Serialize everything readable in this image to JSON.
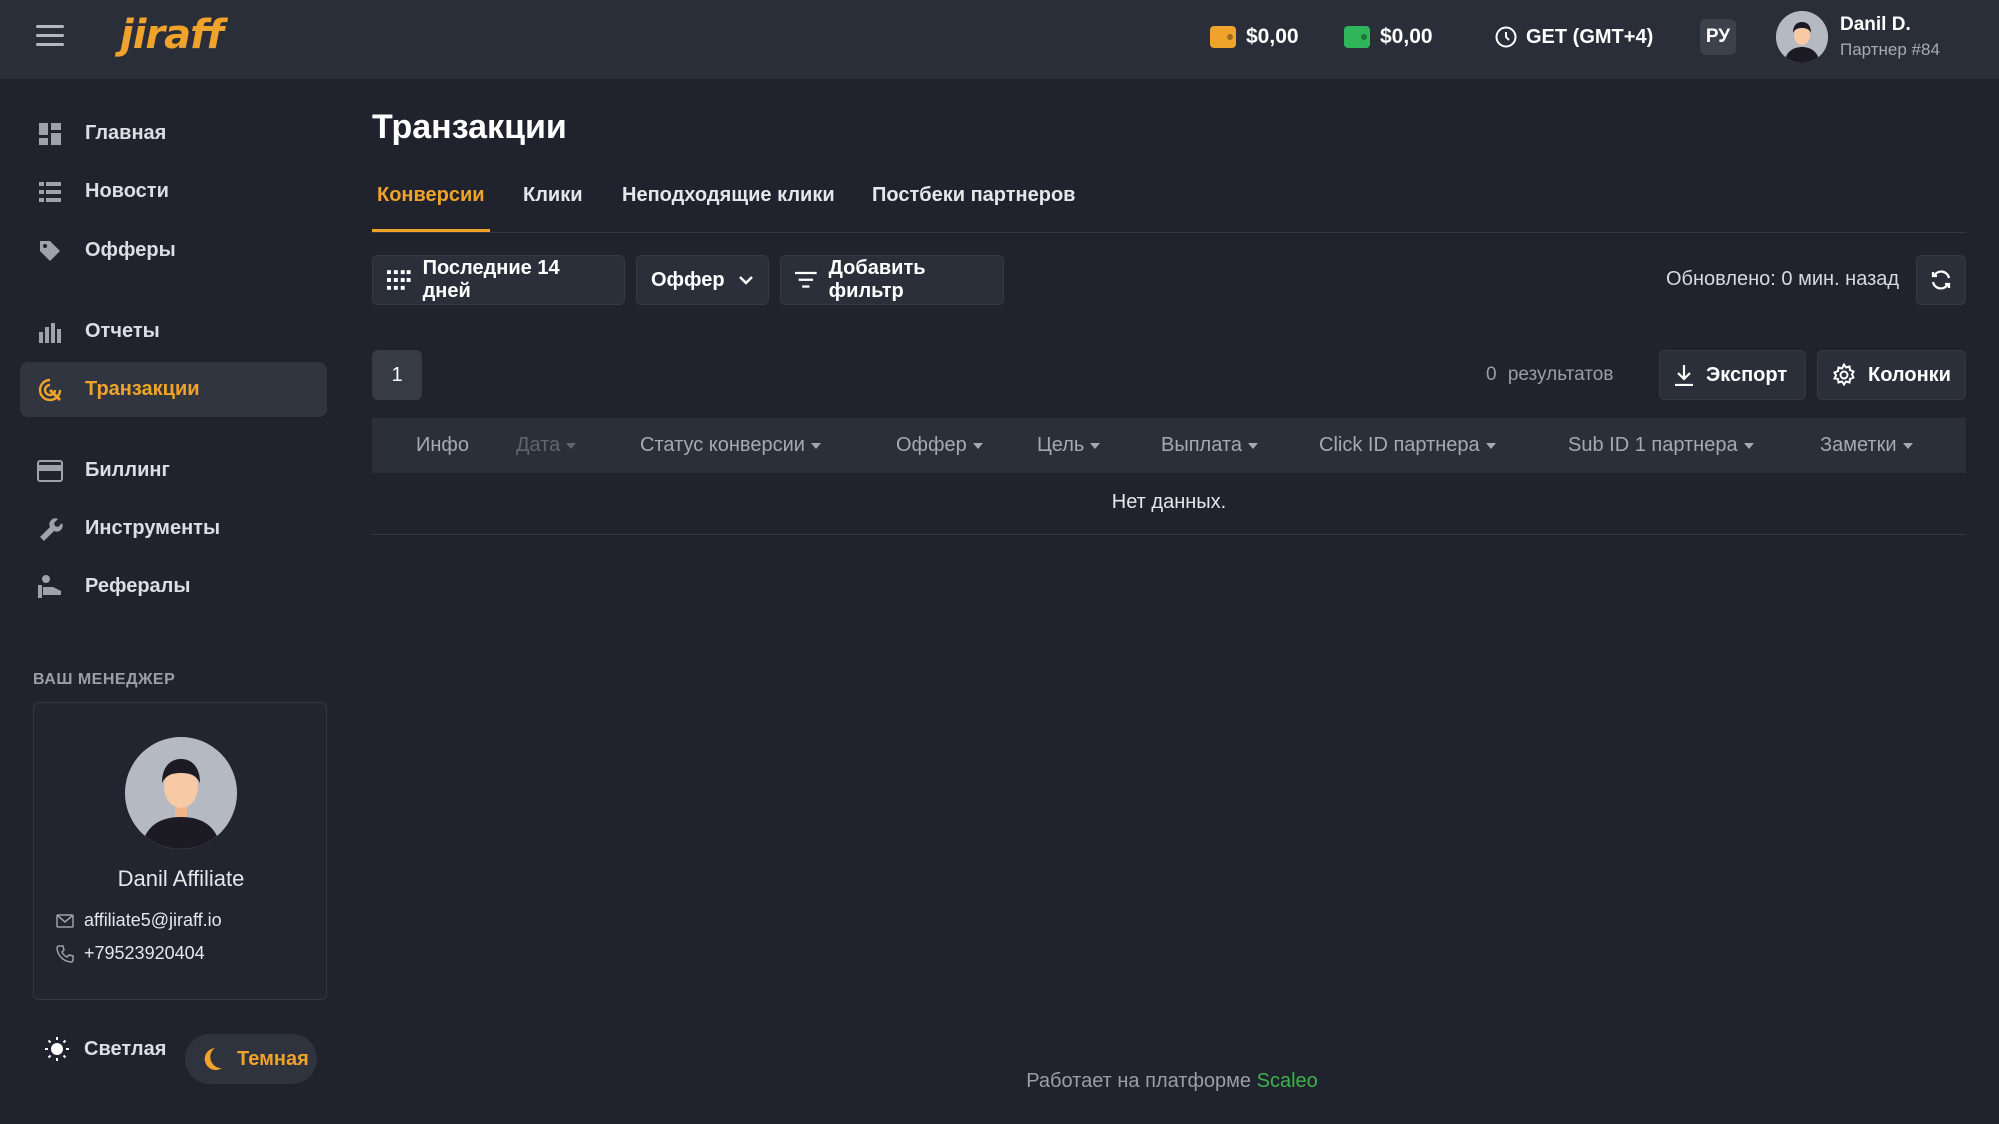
{
  "header": {
    "logo": "jiraff",
    "balance_1": "$0,00",
    "balance_2": "$0,00",
    "timezone": "GET (GMT+4)",
    "lang": "РУ",
    "user_name": "Danil D.",
    "user_role": "Партнер #84"
  },
  "sidebar": {
    "items": [
      {
        "label": "Главная",
        "icon": "dashboard-icon"
      },
      {
        "label": "Новости",
        "icon": "news-icon"
      },
      {
        "label": "Офферы",
        "icon": "tag-icon"
      },
      {
        "label": "Отчеты",
        "icon": "bar-chart-icon"
      },
      {
        "label": "Транзакции",
        "icon": "transactions-icon"
      },
      {
        "label": "Биллинг",
        "icon": "credit-card-icon"
      },
      {
        "label": "Инструменты",
        "icon": "wrench-icon"
      },
      {
        "label": "Рефералы",
        "icon": "referral-icon"
      }
    ],
    "manager_label": "ВАШ МЕНЕДЖЕР",
    "manager": {
      "name": "Danil Affiliate",
      "email": "affiliate5@jiraff.io",
      "phone": "+79523920404"
    },
    "theme_light": "Светлая",
    "theme_dark": "Темная"
  },
  "main": {
    "title": "Транзакции",
    "tabs": [
      "Конверсии",
      "Клики",
      "Неподходящие клики",
      "Постбеки партнеров"
    ],
    "filters": {
      "date_range": "Последние 14 дней",
      "offer": "Оффер",
      "add_filter": "Добавить фильтр"
    },
    "updated": "Обновлено: 0 мин. назад",
    "page": "1",
    "results": "0 результатов",
    "export": "Экспорт",
    "columns": "Колонки",
    "table_headers": [
      "Инфо",
      "Дата",
      "Статус конверсии",
      "Оффер",
      "Цель",
      "Выплата",
      "Click ID партнера",
      "Sub ID 1 партнера",
      "Заметки"
    ],
    "empty": "Нет данных."
  },
  "footer": {
    "text": "Работает на платформе",
    "link": "Scaleo"
  },
  "colors": {
    "accent": "#f0a32a",
    "wallet_1": "#f0a32a",
    "wallet_2": "#2fb55a",
    "link": "#3cb34a"
  }
}
